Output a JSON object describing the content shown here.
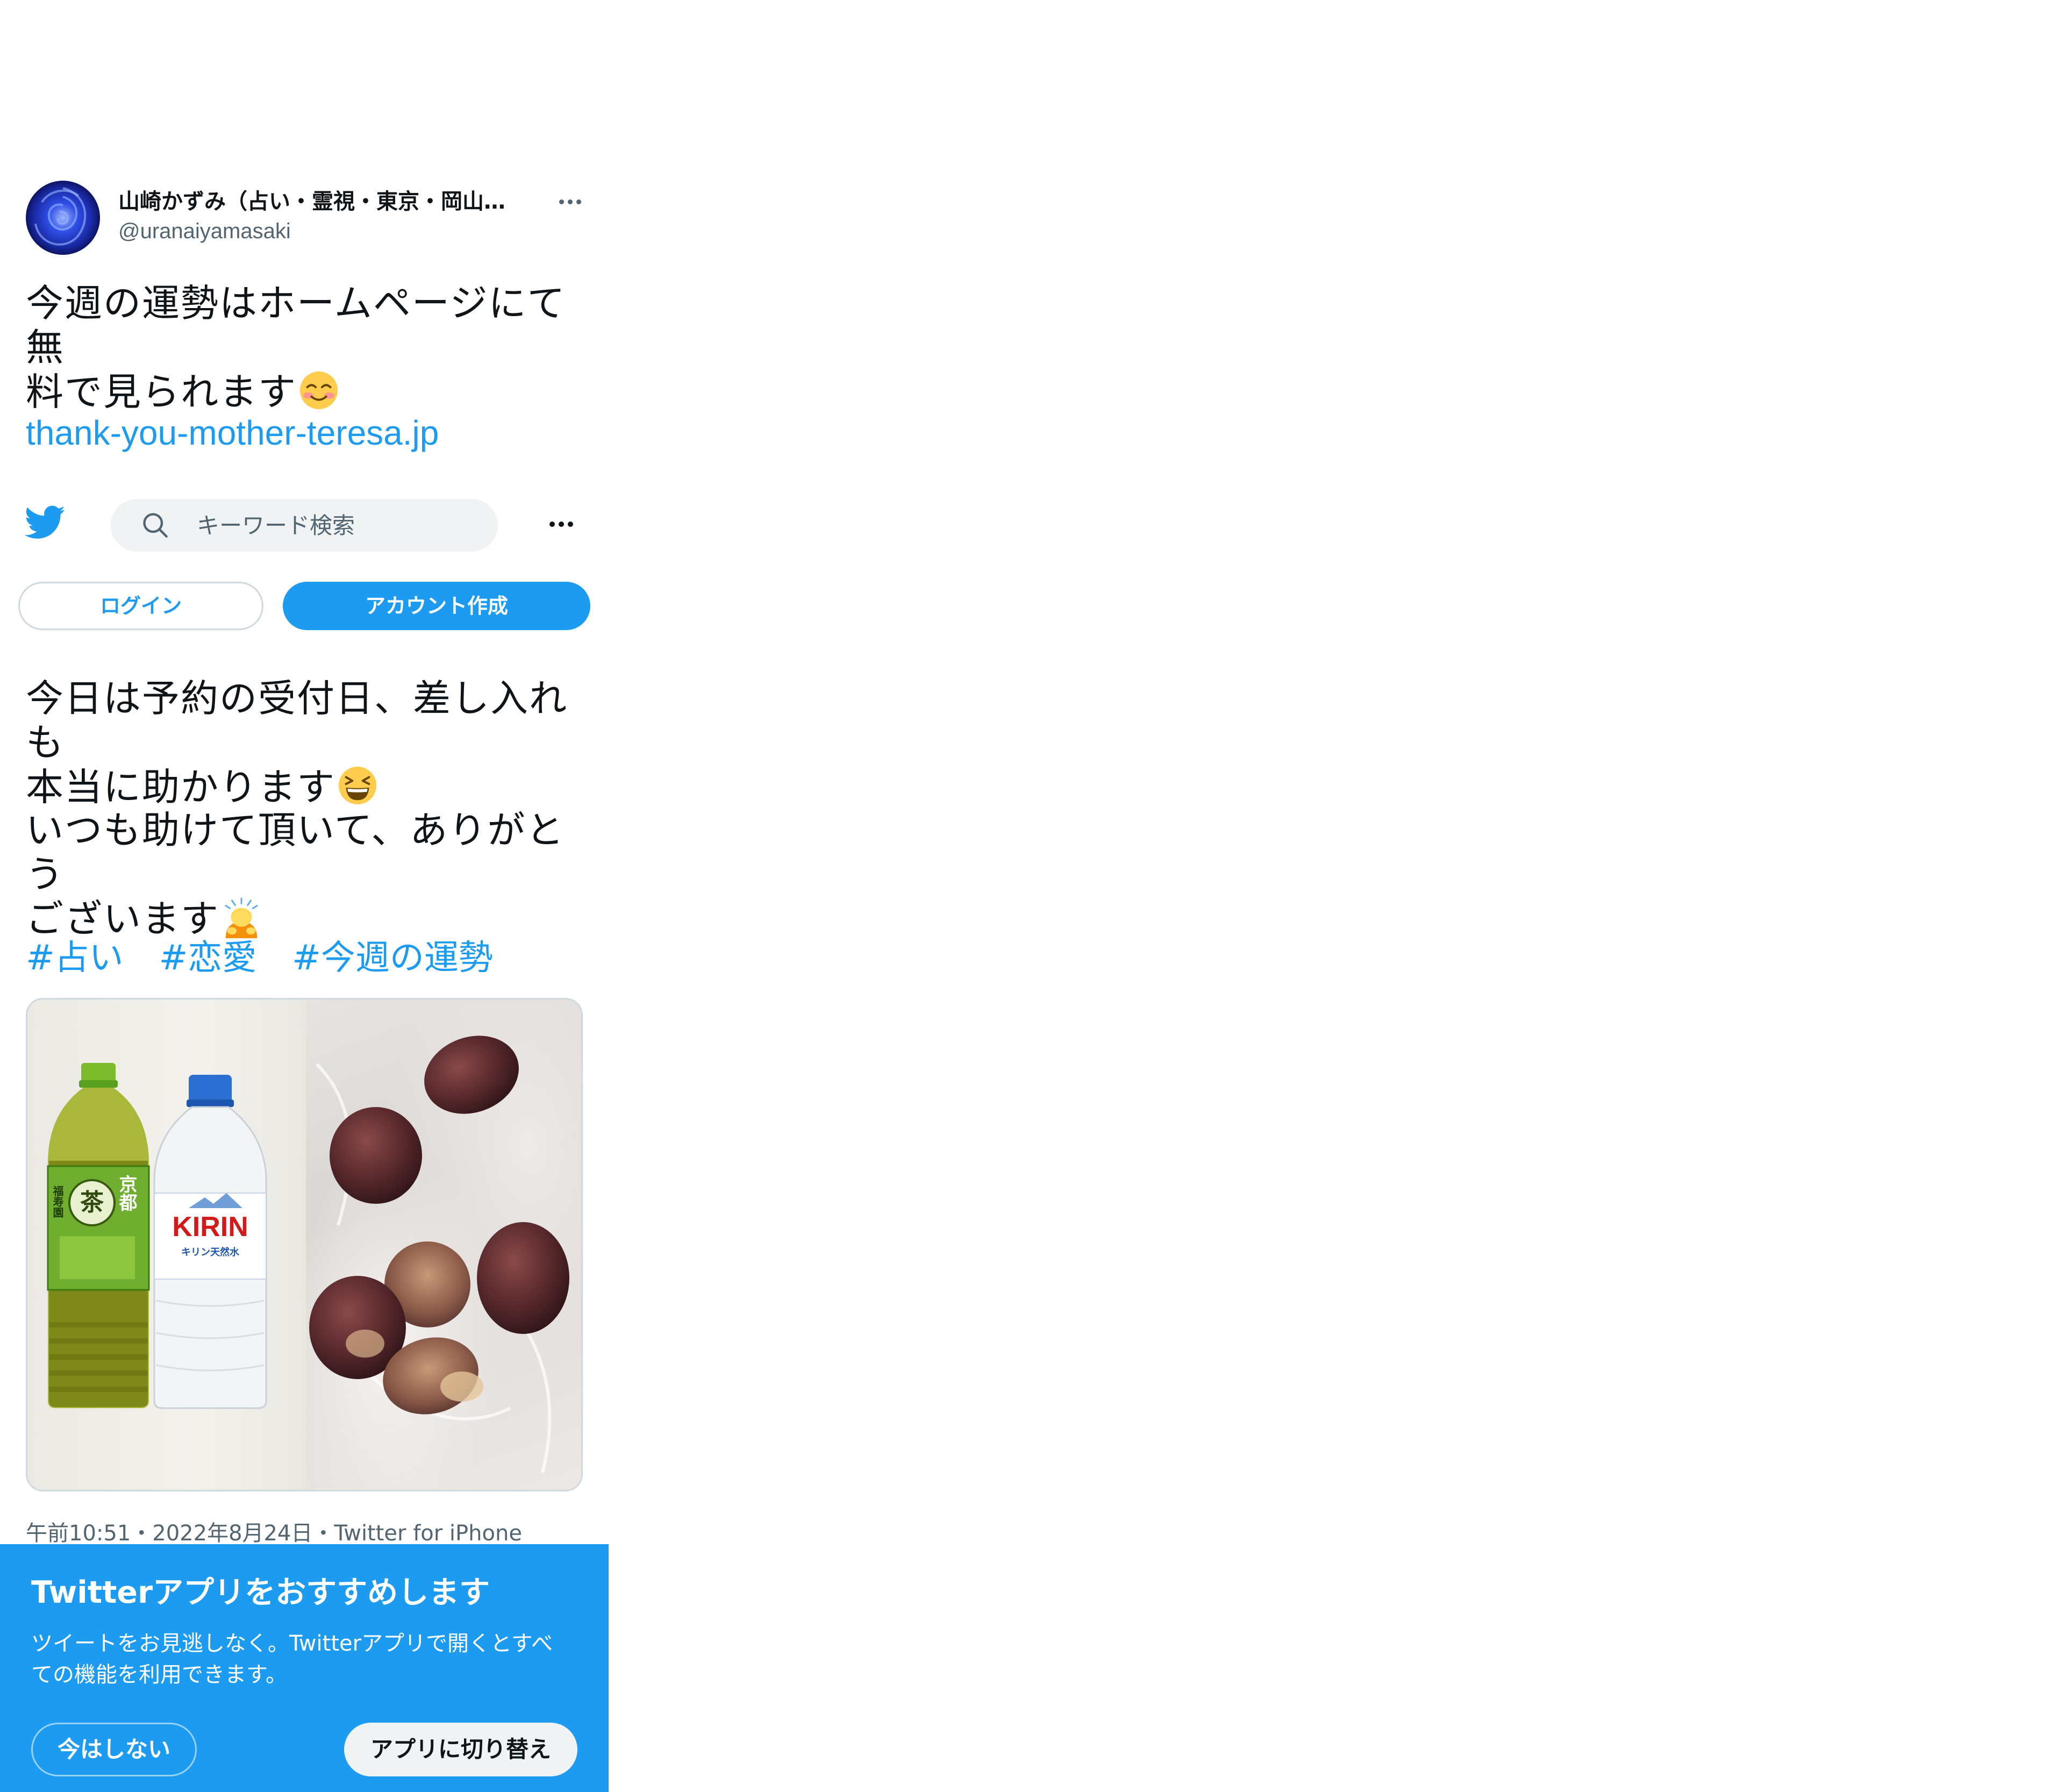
{
  "header": {
    "display_name": "山崎かずみ（占い・霊視・東京・岡山…",
    "handle": "@uranaiyamasaki",
    "more_icon": "more-horizontal-icon",
    "avatar_icon": "blue-rose-avatar"
  },
  "tweet_top": {
    "line1": "今週の運勢はホームページにて無",
    "line2": "料で見られます",
    "emoji": "smiling-face-icon",
    "link": "thank-you-mother-teresa.jp"
  },
  "nav": {
    "logo_icon": "twitter-bird-icon",
    "search_icon": "search-icon",
    "search_placeholder": "キーワード検索",
    "more_icon": "more-horizontal-icon",
    "login_label": "ログイン",
    "signup_label": "アカウント作成"
  },
  "tweet_body": {
    "p1_line1": "今日は予約の受付日、差し入れも",
    "p1_line2": "本当に助かります",
    "p1_emoji": "grinning-squinting-face-icon",
    "p2_line1": "いつも助けて頂いて、ありがとう",
    "p2_line2": "ございます",
    "p2_emoji": "person-bowing-icon",
    "hashtags": [
      "#占い",
      "#恋愛",
      "#今週の運勢"
    ]
  },
  "media": {
    "left_photo": "green-tea-and-water-bottles-photo",
    "right_photo": "figs-on-plastic-bag-photo",
    "bottle_labels": {
      "tea_brand": "京都",
      "tea_kanji": "茶",
      "tea_maker": "福寿園",
      "water_brand": "KIRIN",
      "water_sub": "キリン天然水"
    }
  },
  "timestamp": "午前10:51・2022年8月24日・Twitter for iPhone",
  "app_banner": {
    "title": "Twitterアプリをおすすめします",
    "body_line1": "ツイートをお見逃しなく。Twitterアプリで開くとすべ",
    "body_line2": "ての機能を利用できます。",
    "dismiss_label": "今はしない",
    "switch_label": "アプリに切り替え"
  },
  "colors": {
    "accent": "#1d9bf0",
    "text": "#0f1419",
    "secondary_text": "#536471",
    "search_bg": "#eff3f4"
  }
}
